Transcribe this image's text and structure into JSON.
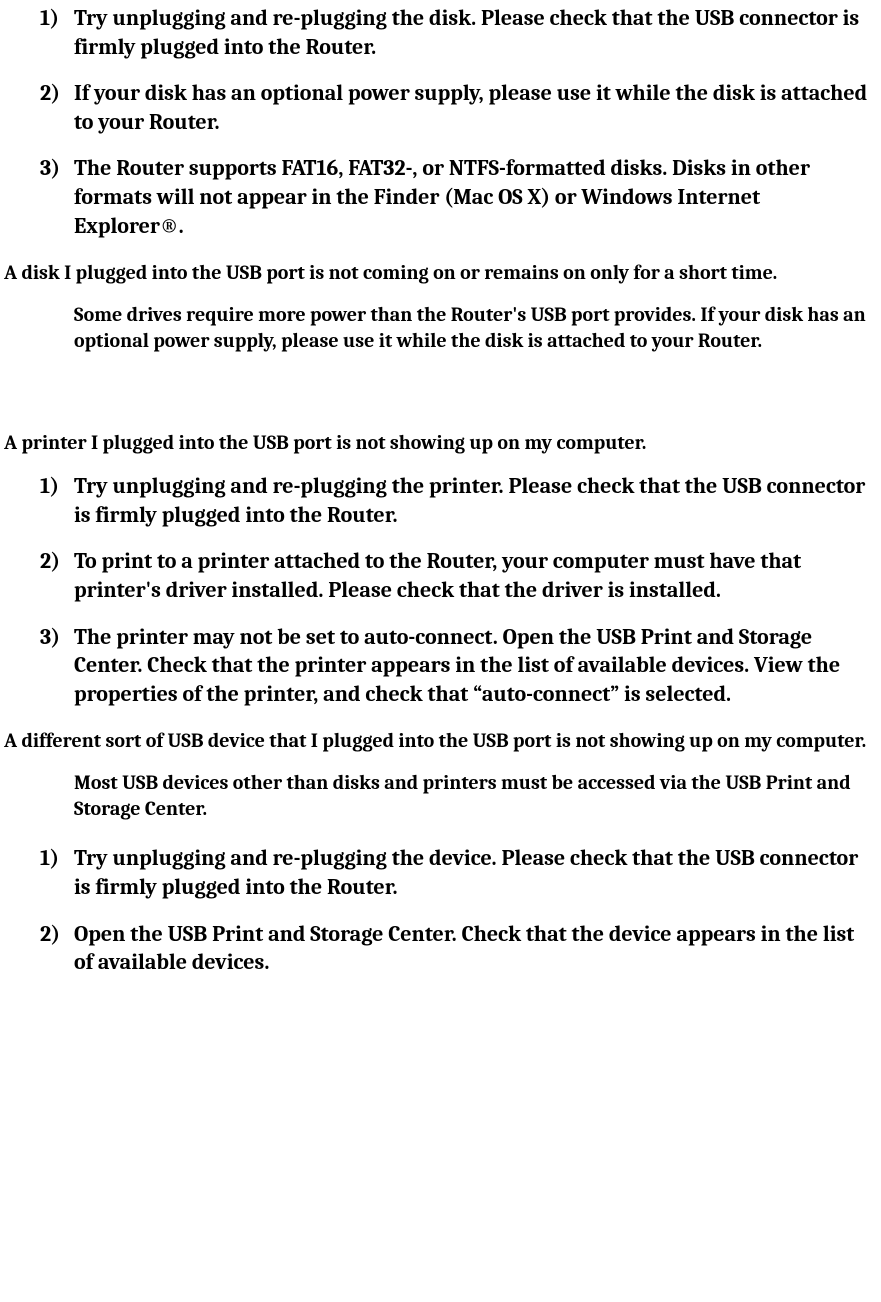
{
  "section1": {
    "items": [
      {
        "num": "1)",
        "text": "Try unplugging and re-plugging the disk. Please check that the USB connector is firmly plugged into the Router."
      },
      {
        "num": "2)",
        "text": "If your disk has an optional power supply, please use it while the disk is attached to your Router."
      },
      {
        "num": "3)",
        "text": "The Router supports FAT16, FAT32-, or NTFS-formatted disks. Disks in other formats will not appear in the Finder (Mac OS X) or Windows Internet Explorer®."
      }
    ]
  },
  "section2": {
    "heading": "A disk I plugged into the USB port is not coming on or remains on only for a short time.",
    "para": "Some drives require more power than the Router's USB port provides. If your disk has an optional power supply, please use it while the disk is attached to your Router."
  },
  "section3": {
    "heading": "A printer I plugged into the USB port is not showing up on my computer.",
    "items": [
      {
        "num": "1)",
        "text": "Try unplugging and re-plugging the printer. Please check that the USB connector is firmly plugged into the Router."
      },
      {
        "num": "2)",
        "text": "To print to a printer attached to the Router, your computer must have that printer's driver installed. Please check that the driver is installed."
      },
      {
        "num": "3)",
        "text": "The printer may not be set to auto-connect. Open the USB Print and Storage Center. Check that the printer appears in the list of available devices. View the properties of the printer, and check that “auto-connect” is selected."
      }
    ]
  },
  "section4": {
    "heading": "A different sort of USB device that I plugged into the USB port is not showing up on my computer.",
    "para": "Most USB devices other than disks and printers must be accessed via the USB Print and Storage Center.",
    "items": [
      {
        "num": "1)",
        "text": "Try unplugging and re-plugging the device. Please check that the USB connector is firmly plugged into the Router."
      },
      {
        "num": "2)",
        "text": "Open the USB Print and Storage Center. Check that the device appears in the list of available devices."
      }
    ]
  }
}
